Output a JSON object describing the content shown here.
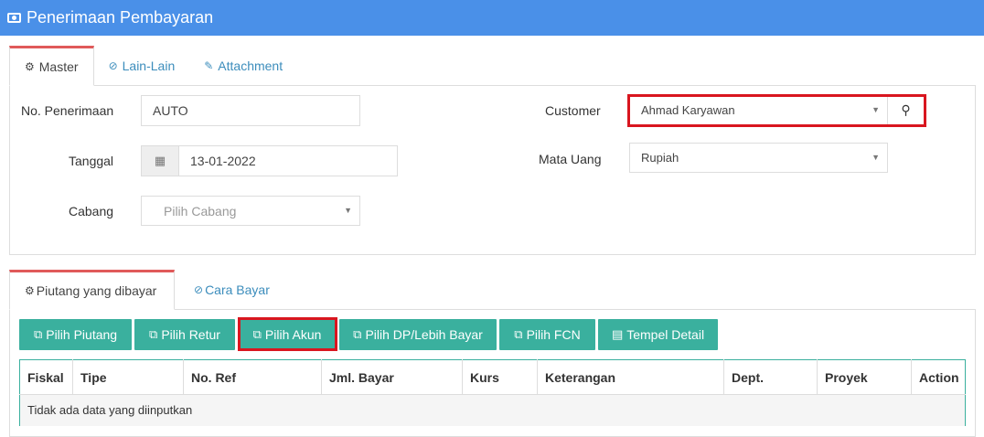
{
  "title": "Penerimaan Pembayaran",
  "tabs1": [
    "Master",
    "Lain-Lain",
    "Attachment"
  ],
  "form": {
    "no_label": "No. Penerimaan",
    "no_value": "AUTO",
    "tanggal_label": "Tanggal",
    "tanggal_value": "13-01-2022",
    "cabang_label": "Cabang",
    "cabang_placeholder": "Pilih Cabang",
    "customer_label": "Customer",
    "customer_value": "Ahmad Karyawan",
    "mata_uang_label": "Mata Uang",
    "mata_uang_value": "Rupiah"
  },
  "tabs2": [
    "Piutang yang dibayar",
    "Cara Bayar"
  ],
  "buttons": [
    "Pilih Piutang",
    "Pilih Retur",
    "Pilih Akun",
    "Pilih DP/Lebih Bayar",
    "Pilih FCN",
    "Tempel Detail"
  ],
  "table": {
    "headers": [
      "Fiskal",
      "Tipe",
      "No. Ref",
      "Jml. Bayar",
      "Kurs",
      "Keterangan",
      "Dept.",
      "Proyek",
      "Action"
    ],
    "empty_text": "Tidak ada data yang diinputkan"
  },
  "icons": {
    "title": "money-icon",
    "tab_master": "gears-icon",
    "tab_lain": "check-circle-icon",
    "tab_attachment": "paperclip-icon",
    "calendar": "calendar-icon",
    "search": "search-icon"
  },
  "colors": {
    "header_bg": "#4a90e8",
    "button_bg": "#3ab09e",
    "highlight": "#d9161f",
    "tab_accent": "#e05a5a",
    "link": "#3c8dbc"
  }
}
